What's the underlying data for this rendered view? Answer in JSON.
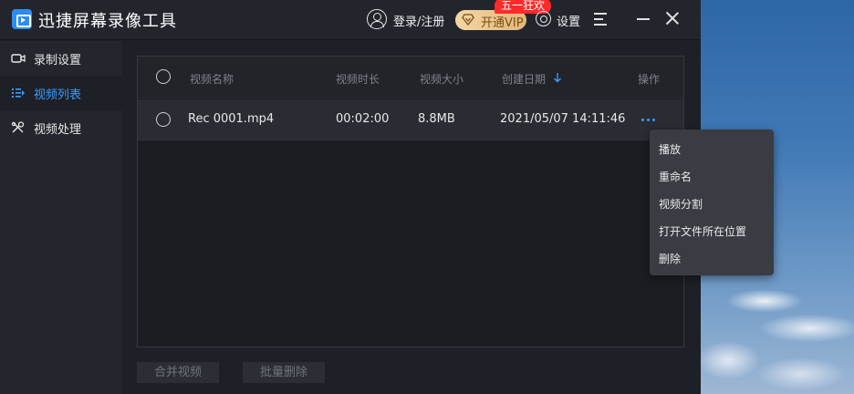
{
  "app": {
    "title": "迅捷屏幕录像工具"
  },
  "header": {
    "login_label": "登录/注册",
    "vip_label": "开通VIP",
    "promo_badge": "五一狂欢",
    "settings_label": "设置"
  },
  "sidebar": {
    "items": [
      {
        "label": "录制设置",
        "icon": "video-camera-icon",
        "active": false
      },
      {
        "label": "视频列表",
        "icon": "list-icon",
        "active": true
      },
      {
        "label": "视频处理",
        "icon": "tools-icon",
        "active": false
      }
    ]
  },
  "table": {
    "columns": [
      "视频名称",
      "视频时长",
      "视频大小",
      "创建日期",
      "操作"
    ],
    "rows": [
      {
        "name": "Rec 0001.mp4",
        "duration": "00:02:00",
        "size": "8.8MB",
        "created": "2021/05/07 14:11:46"
      }
    ]
  },
  "context_menu": {
    "items": [
      "播放",
      "重命名",
      "视频分割",
      "打开文件所在位置",
      "删除"
    ]
  },
  "footer": {
    "merge_label": "合并视频",
    "batch_delete_label": "批量删除"
  },
  "colors": {
    "accent": "#3b9cff",
    "promo": "#ff2b2b",
    "vip_gold": "#e2b77a"
  }
}
